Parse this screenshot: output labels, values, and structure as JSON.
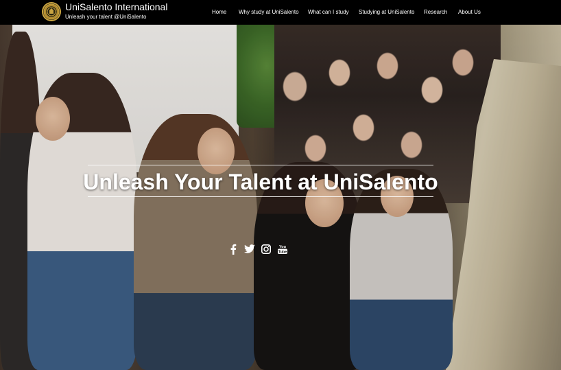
{
  "brand": {
    "title": "UniSalento International",
    "subtitle": "Unleash your talent @UniSalento"
  },
  "nav": {
    "items": [
      {
        "label": "Home"
      },
      {
        "label": "Why study at UniSalento"
      },
      {
        "label": "What can I study"
      },
      {
        "label": "Studying at UniSalento"
      },
      {
        "label": "Research"
      },
      {
        "label": "About Us"
      }
    ]
  },
  "hero": {
    "title": "Unleash Your Talent at UniSalento"
  },
  "social": {
    "icons": [
      "facebook-icon",
      "twitter-icon",
      "instagram-icon",
      "youtube-icon"
    ],
    "youtube_label": "You Tube"
  },
  "colors": {
    "navbar_bg": "#000000",
    "text": "#ffffff",
    "logo_gold": "#c9a442"
  }
}
